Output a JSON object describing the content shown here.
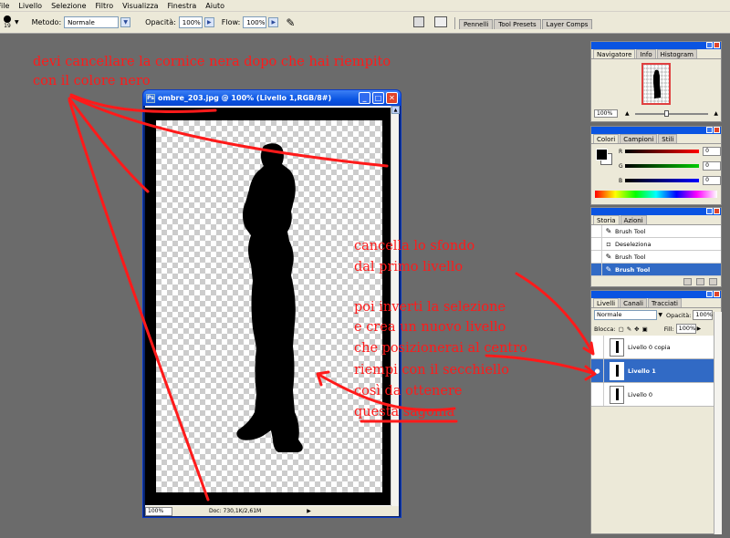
{
  "menu": [
    "File",
    "Livello",
    "Selezione",
    "Filtro",
    "Visualizza",
    "Finestra",
    "Aiuto"
  ],
  "options": {
    "brush_size": "19",
    "metodo_label": "Metodo:",
    "metodo_value": "Normale",
    "opacita_label": "Opacità:",
    "opacita_value": "100%",
    "flow_label": "Flow:",
    "flow_value": "100%"
  },
  "palette_well": [
    "Pennelli",
    "Tool Presets",
    "Layer Comps"
  ],
  "document": {
    "title": "ombre_203.jpg @ 100% (Livello 1,RGB/8#)",
    "zoom": "100%",
    "doc_info": "Doc: 730,1K/2,61M"
  },
  "navigator": {
    "tabs": [
      "Navigatore",
      "Info",
      "Histogram"
    ],
    "zoom": "100%"
  },
  "colors": {
    "tabs": [
      "Colori",
      "Campioni",
      "Stili"
    ],
    "channels": [
      {
        "name": "R",
        "value": "0",
        "color": "#c00000"
      },
      {
        "name": "G",
        "value": "0",
        "color": "#00b000"
      },
      {
        "name": "B",
        "value": "0",
        "color": "#0000c0"
      }
    ]
  },
  "history": {
    "tabs": [
      "Storia",
      "Azioni"
    ],
    "items": [
      "Brush Tool",
      "Deseleziona",
      "Brush Tool",
      "Brush Tool"
    ]
  },
  "layers": {
    "tabs": [
      "Livelli",
      "Canali",
      "Tracciati"
    ],
    "blend": "Normale",
    "opacity_label": "Opacità:",
    "opacity": "100%",
    "lock_label": "Blocca:",
    "fill_label": "Fill:",
    "fill": "100%",
    "items": [
      "Livello 0 copia",
      "Livello 1",
      "Livello 0"
    ]
  },
  "annotations": {
    "top_line1": "devi cancellare la cornice nera dopo che hai riempito",
    "top_line2": "con il colore nero",
    "right_lines": [
      "cancella lo sfondo",
      "dal primo livello",
      "",
      "poi inverti la selezione",
      "e crea un nuovo livello",
      "che posizionerai al centro",
      "riempi con il secchiello",
      "così da ottenere",
      "questa sagoma"
    ]
  },
  "colors_theme": {
    "annotation": "#ff1a1a",
    "titlebar": "#0a54e2",
    "selection": "#316ac5"
  }
}
